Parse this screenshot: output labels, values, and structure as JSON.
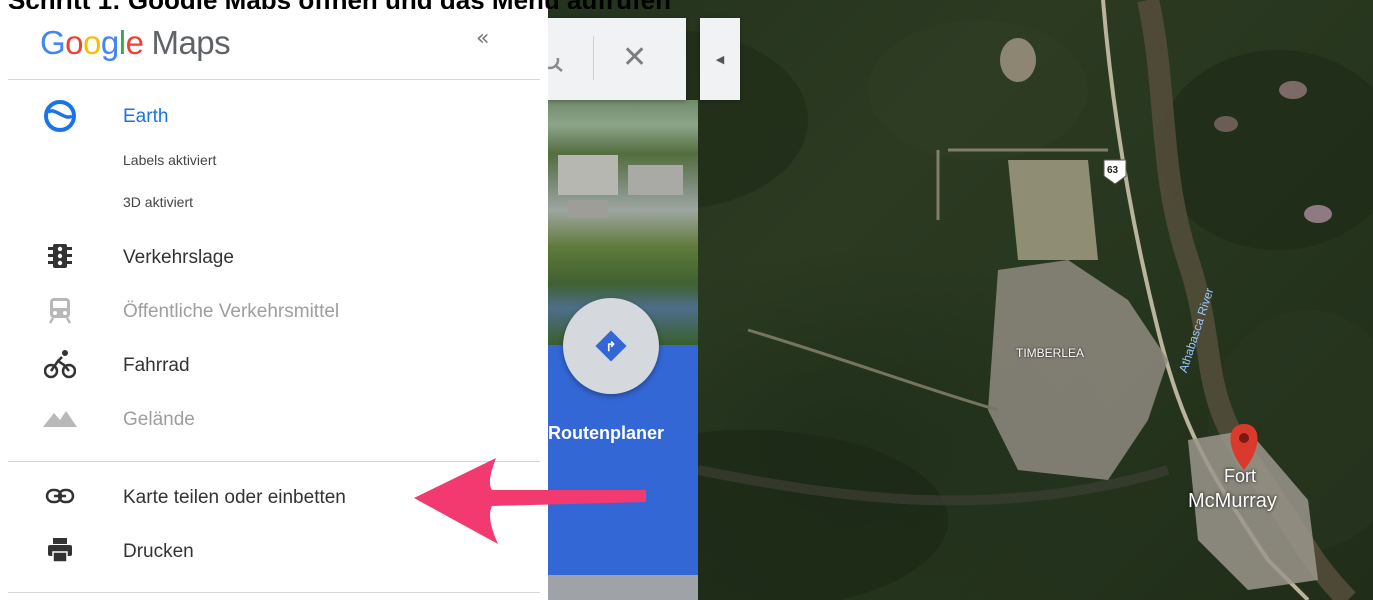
{
  "top_caption": "Schritt 1: Google Maps öffnen und das Menü aufrufen",
  "sidebar": {
    "logo_word": [
      "G",
      "o",
      "o",
      "g",
      "l",
      "e"
    ],
    "logo_maps": "Maps",
    "collapse_glyph": "«",
    "layers": [
      {
        "label": "Earth",
        "icon": "earth-icon",
        "state": "active"
      },
      {
        "label": "Verkehrslage",
        "icon": "traffic-light-icon",
        "state": "normal"
      },
      {
        "label": "Öffentliche Verkehrsmittel",
        "icon": "train-icon",
        "state": "disabled"
      },
      {
        "label": "Fahrrad",
        "icon": "bicycle-icon",
        "state": "normal"
      },
      {
        "label": "Gelände",
        "icon": "terrain-icon",
        "state": "disabled"
      }
    ],
    "earth_sublabels": [
      "Labels aktiviert",
      "3D aktiviert"
    ],
    "actions": [
      {
        "label": "Karte teilen oder einbetten",
        "icon": "link-icon"
      },
      {
        "label": "Drucken",
        "icon": "print-icon"
      }
    ]
  },
  "search": {
    "close_glyph": "✕",
    "panel_toggle_glyph": "◀"
  },
  "route": {
    "label": "Routenplaner",
    "glyph": "↱"
  },
  "map": {
    "labels": {
      "highway": "63",
      "place": "TIMBERLEA",
      "city_line1": "Fort",
      "city_line2": "McMurray",
      "river": "Athabasca River"
    }
  },
  "colors": {
    "accent": "#1a73e8",
    "route_blue": "#3367d6",
    "arrow_pink": "#f23a71",
    "pin_red": "#d93a2b"
  }
}
